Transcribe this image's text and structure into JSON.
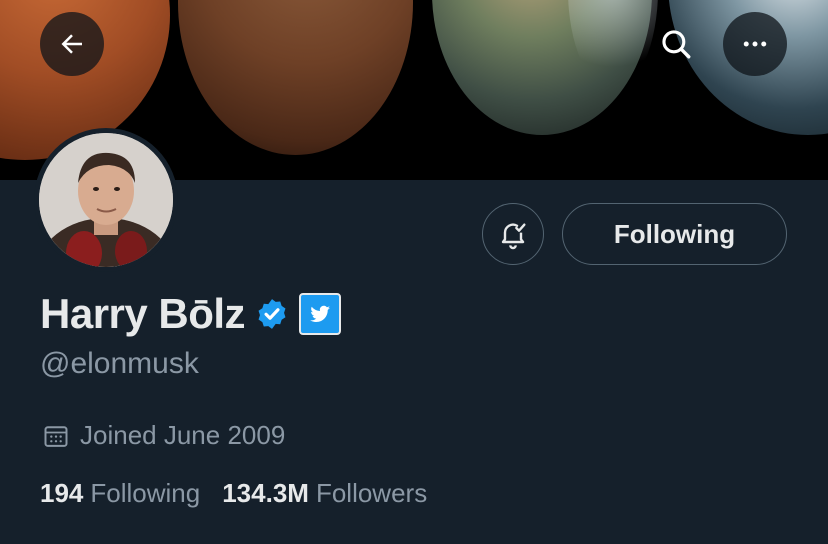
{
  "header": {
    "icons": {
      "back": "arrow-left-icon",
      "search": "search-icon",
      "more": "more-horizontal-icon"
    }
  },
  "profile": {
    "display_name": "Harry Bōlz",
    "handle": "@elonmusk",
    "joined": "Joined June 2009",
    "verified_badge_color": "#1d9bf0",
    "affiliation_badge": "twitter-bird-icon"
  },
  "actions": {
    "notifications_icon": "bell-check-icon",
    "follow_label": "Following"
  },
  "stats": {
    "following_count": "194",
    "following_label": "Following",
    "followers_count": "134.3M",
    "followers_label": "Followers"
  },
  "colors": {
    "background": "#15202b",
    "secondary_text": "#8b98a5",
    "border": "#536471",
    "accent": "#1d9bf0"
  }
}
